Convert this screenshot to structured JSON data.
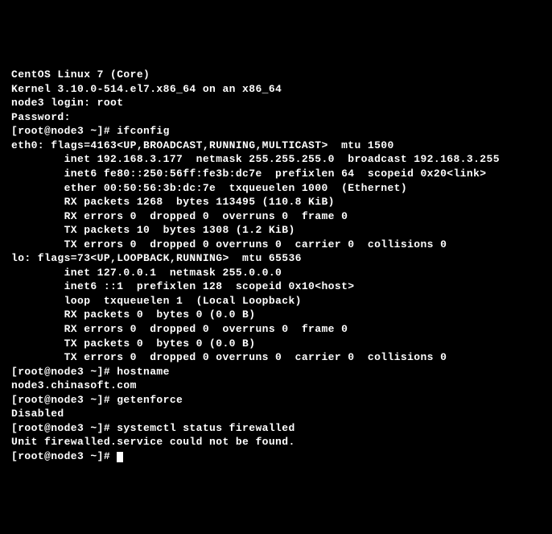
{
  "lines": [
    "CentOS Linux 7 (Core)",
    "Kernel 3.10.0-514.el7.x86_64 on an x86_64",
    "",
    "node3 login: root",
    "Password:",
    "[root@node3 ~]# ifconfig",
    "eth0: flags=4163<UP,BROADCAST,RUNNING,MULTICAST>  mtu 1500",
    "        inet 192.168.3.177  netmask 255.255.255.0  broadcast 192.168.3.255",
    "        inet6 fe80::250:56ff:fe3b:dc7e  prefixlen 64  scopeid 0x20<link>",
    "        ether 00:50:56:3b:dc:7e  txqueuelen 1000  (Ethernet)",
    "        RX packets 1268  bytes 113495 (110.8 KiB)",
    "        RX errors 0  dropped 0  overruns 0  frame 0",
    "        TX packets 10  bytes 1308 (1.2 KiB)",
    "        TX errors 0  dropped 0 overruns 0  carrier 0  collisions 0",
    "",
    "lo: flags=73<UP,LOOPBACK,RUNNING>  mtu 65536",
    "        inet 127.0.0.1  netmask 255.0.0.0",
    "        inet6 ::1  prefixlen 128  scopeid 0x10<host>",
    "        loop  txqueuelen 1  (Local Loopback)",
    "        RX packets 0  bytes 0 (0.0 B)",
    "        RX errors 0  dropped 0  overruns 0  frame 0",
    "        TX packets 0  bytes 0 (0.0 B)",
    "        TX errors 0  dropped 0 overruns 0  carrier 0  collisions 0",
    "",
    "[root@node3 ~]# hostname",
    "node3.chinasoft.com",
    "[root@node3 ~]# getenforce",
    "Disabled",
    "[root@node3 ~]# systemctl status firewalled",
    "Unit firewalled.service could not be found.",
    "[root@node3 ~]# "
  ]
}
